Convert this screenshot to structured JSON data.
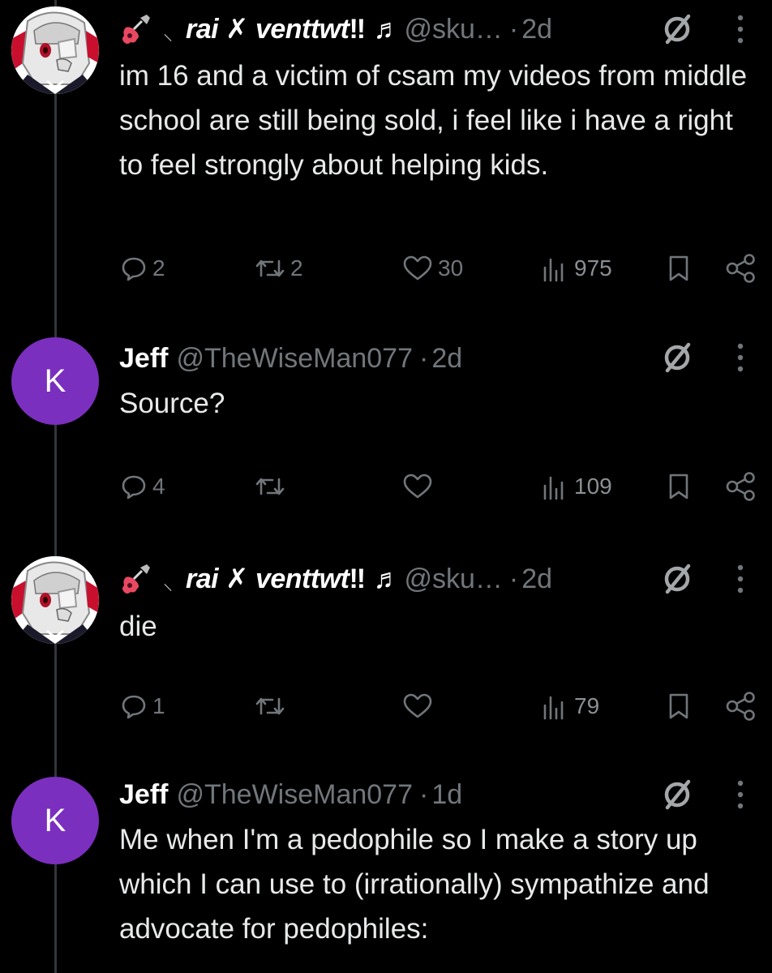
{
  "tweets": [
    {
      "author_prefix_glyph": "⸜",
      "author_name": "rai ✗ venttwt",
      "author_suffix": " ‼ ♬ ",
      "handle": "@sku…",
      "separator": "·",
      "time": "2d",
      "text": "im 16 and a victim of csam my videos from middle school are still being sold, i feel like i have a right to feel strongly about helping kids.",
      "replies": "2",
      "reposts": "2",
      "likes": "30",
      "views": "975",
      "avatar_icon": "anime-avatar-icon"
    },
    {
      "avatar_letter": "K",
      "author_name": "Jeff",
      "handle": "@TheWiseMan077",
      "separator": "·",
      "time": "2d",
      "text": "Source?",
      "replies": "4",
      "reposts": "",
      "likes": "",
      "views": "109"
    },
    {
      "author_prefix_glyph": "⸜",
      "author_name": "rai ✗ venttwt",
      "author_suffix": " ‼ ♬ ",
      "handle": "@sku…",
      "separator": "·",
      "time": "2d",
      "text": "die",
      "replies": "1",
      "reposts": "",
      "likes": "",
      "views": "79",
      "avatar_icon": "anime-avatar-icon"
    },
    {
      "avatar_letter": "K",
      "author_name": "Jeff",
      "handle": "@TheWiseMan077",
      "separator": "·",
      "time": "1d",
      "text": "Me when I'm a pedophile so I make a story up which I can use to (irrationally) sympathize and advocate for pedophiles:",
      "replies": "",
      "reposts": "",
      "likes": "",
      "views": ""
    }
  ],
  "colors": {
    "background": "#000000",
    "text": "#e7e9ea",
    "secondary": "#71767b",
    "avatar_k": "#7b2fbe",
    "thread_line": "#333639"
  }
}
